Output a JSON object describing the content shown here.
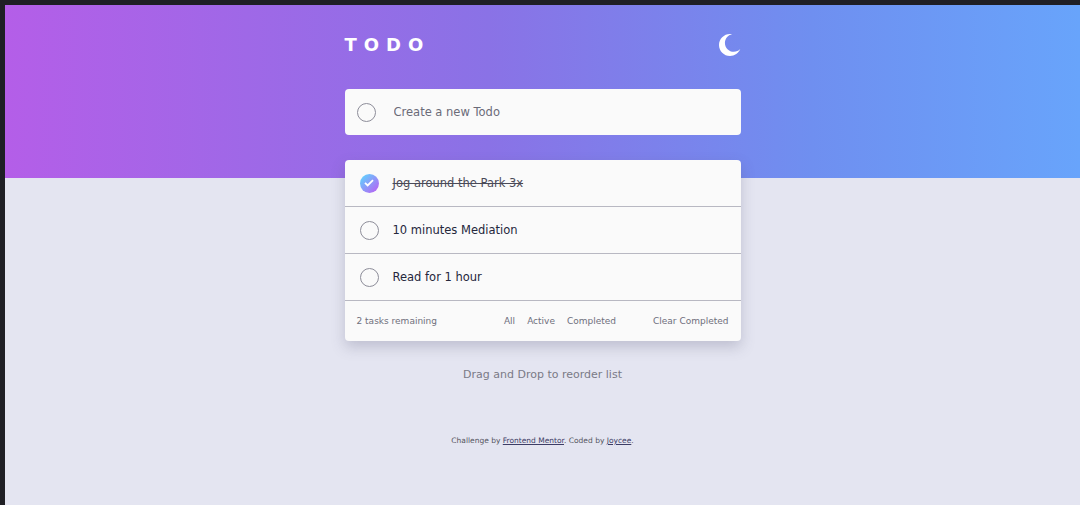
{
  "app": {
    "title": "TODO"
  },
  "new_todo": {
    "placeholder": "Create a new Todo"
  },
  "todos": [
    {
      "text": "Jog around the Park 3x",
      "completed": true
    },
    {
      "text": "10 minutes Mediation",
      "completed": false
    },
    {
      "text": "Read for 1 hour",
      "completed": false
    }
  ],
  "footer": {
    "remaining": "2 tasks remaining",
    "clear": "Clear Completed"
  },
  "filters": [
    {
      "label": "All",
      "selected": false
    },
    {
      "label": "Active",
      "selected": false
    },
    {
      "label": "Completed",
      "selected": false
    }
  ],
  "hint": "Drag and Drop to reorder list",
  "attribution": {
    "prefix": "Challenge by ",
    "link1": "Frontend Mentor",
    "middle": ". Coded by ",
    "link2": "Joycee",
    "suffix": "."
  }
}
